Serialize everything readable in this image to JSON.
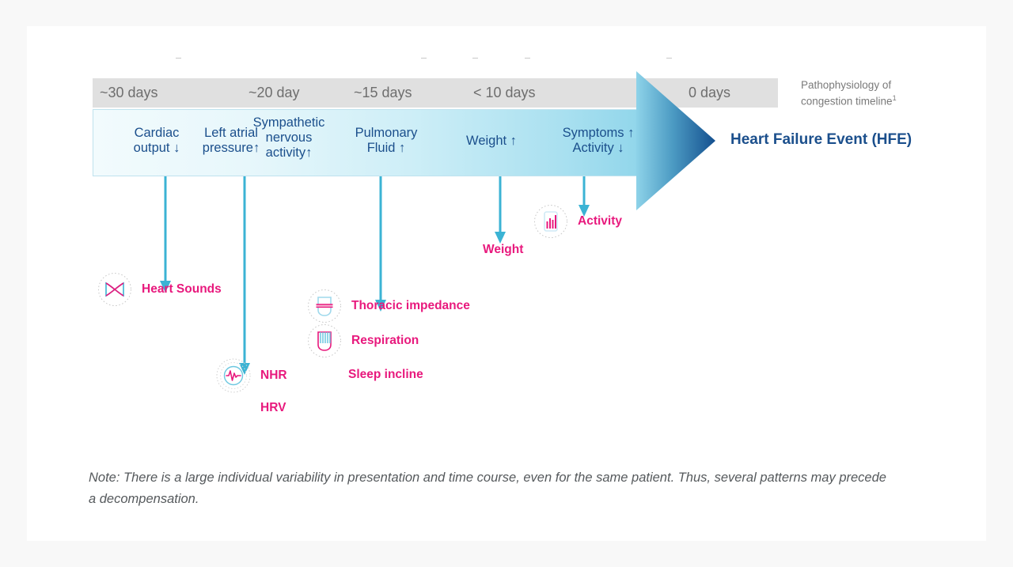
{
  "page": {
    "background_color": "#f8f8f8",
    "card_color": "#ffffff"
  },
  "colors": {
    "pink": "#e8197d",
    "cyan": "#3bb3d4",
    "navy": "#1b4f8c",
    "header_gray": "#e0e0e0",
    "label_gray": "#6e6e6e",
    "note_gray": "#55595c"
  },
  "timeline": {
    "side_note": {
      "line1": "Pathophysiology of",
      "line2": "congestion timeline",
      "superscript": "1"
    },
    "stages": [
      {
        "time": "~30 days",
        "label": "Cardiac\noutput ↓"
      },
      {
        "time": "~20 day",
        "label": "Left atrial\npressure↑"
      },
      {
        "time": "~15 days",
        "label": "Sympathetic\nnervous\nactivity↑"
      },
      {
        "time": "< 10 days",
        "label": "Pulmonary\nFluid ↑"
      },
      {
        "time": "0 days",
        "label": "Weight ↑"
      }
    ],
    "time_labels": [
      "~30 days",
      "~20 day",
      "~15 days",
      "< 10 days",
      "0 days"
    ],
    "band_labels": [
      "Cardiac",
      "output ↓",
      "Left atrial",
      "pressure↑",
      "Sympathetic",
      "nervous",
      "activity↑",
      "Pulmonary",
      "Fluid ↑",
      "Weight ↑",
      "Symptoms ↑",
      "Activity ↓"
    ],
    "event_title": "Heart Failure Event (HFE)"
  },
  "markers": [
    {
      "label": "Heart Sounds",
      "icon": "heart-sounds-icon"
    },
    {
      "label": "NHR",
      "icon": "nhr-waveform-icon"
    },
    {
      "label": "HRV",
      "icon": null
    },
    {
      "label": "Thoracic impedance",
      "icon": "thoracic-impedance-icon"
    },
    {
      "label": "Respiration",
      "icon": "respiration-icon"
    },
    {
      "label": "Sleep incline",
      "icon": null
    },
    {
      "label": "Weight",
      "icon": null
    },
    {
      "label": "Activity",
      "icon": "activity-bars-icon"
    }
  ],
  "note": {
    "text": "Note: There is a large individual variability in presentation and time course, even for the same patient. Thus, several patterns may precede a decompensation."
  }
}
